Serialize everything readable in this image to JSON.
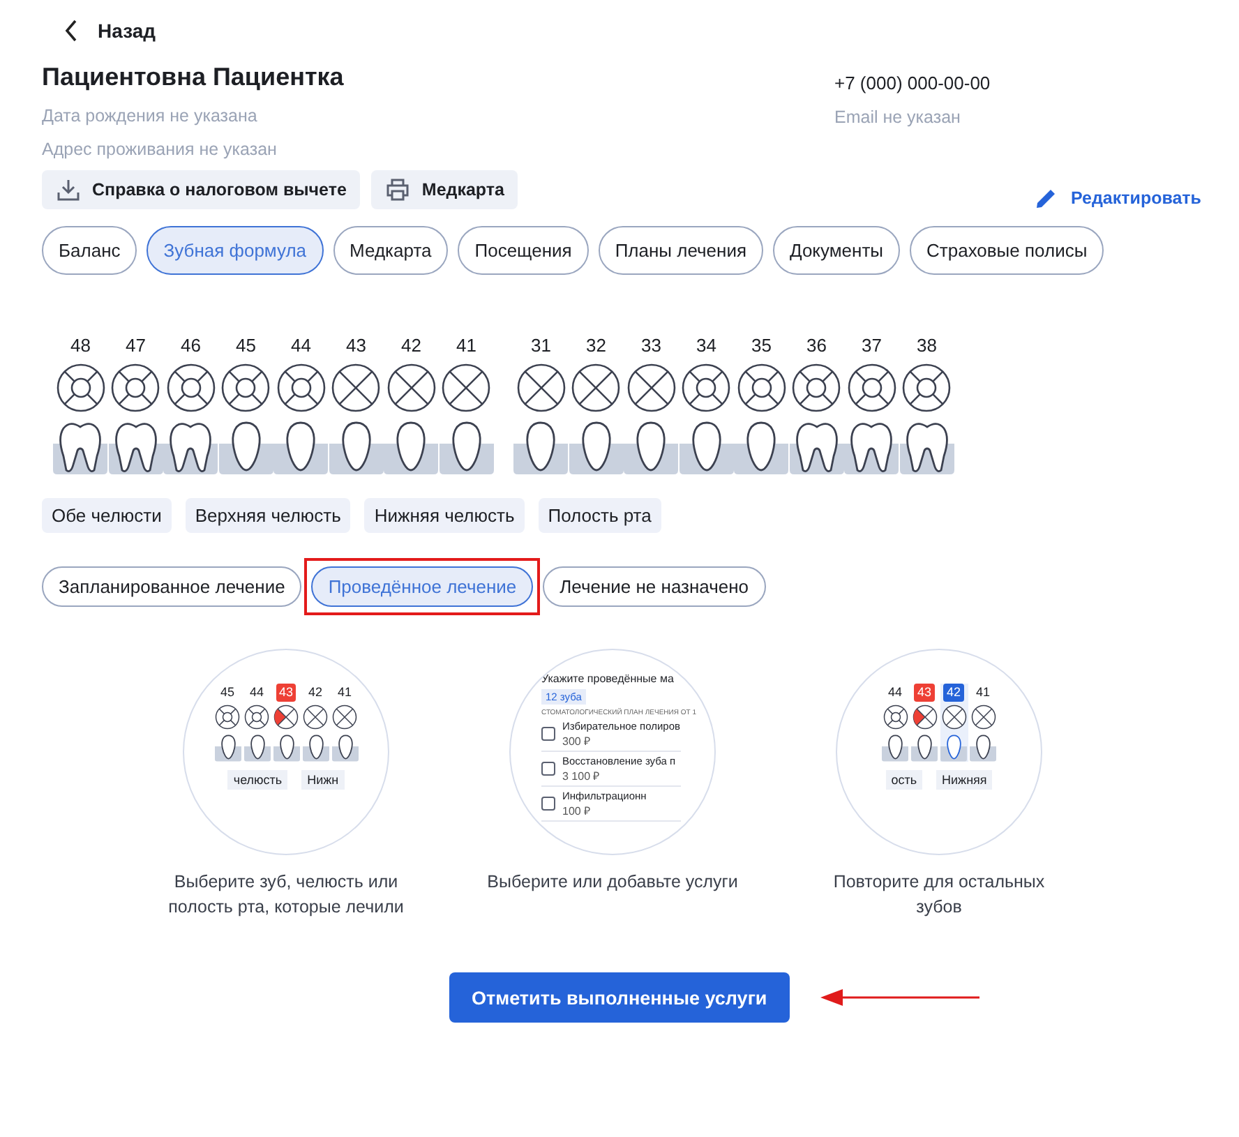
{
  "back": {
    "label": "Назад"
  },
  "patient": {
    "name": "Пациентовна Пациентка",
    "birth": "Дата рождения не указана",
    "address": "Адрес проживания не указан",
    "phone": "+7 (000) 000-00-00",
    "email": "Email не указан"
  },
  "actions": [
    {
      "kind": "download",
      "label": "Справка о налоговом вычете"
    },
    {
      "kind": "print",
      "label": "Медкарта"
    }
  ],
  "edit": {
    "label": "Редактировать"
  },
  "tabs": [
    {
      "label": "Баланс",
      "selected": false
    },
    {
      "label": "Зубная формула",
      "selected": true
    },
    {
      "label": "Медкарта",
      "selected": false
    },
    {
      "label": "Посещения",
      "selected": false
    },
    {
      "label": "Планы лечения",
      "selected": false
    },
    {
      "label": "Документы",
      "selected": false
    },
    {
      "label": "Страховые полисы",
      "selected": false
    }
  ],
  "teeth_groups": [
    [
      {
        "number": "48",
        "kind": "molar",
        "missing": false
      },
      {
        "number": "47",
        "kind": "molar",
        "missing": false
      },
      {
        "number": "46",
        "kind": "molar",
        "missing": false
      },
      {
        "number": "45",
        "kind": "incisor",
        "missing": false
      },
      {
        "number": "44",
        "kind": "incisor",
        "missing": false
      },
      {
        "number": "43",
        "kind": "incisor",
        "missing": true
      },
      {
        "number": "42",
        "kind": "incisor",
        "missing": true
      },
      {
        "number": "41",
        "kind": "incisor",
        "missing": true
      }
    ],
    [
      {
        "number": "31",
        "kind": "incisor",
        "missing": true
      },
      {
        "number": "32",
        "kind": "incisor",
        "missing": true
      },
      {
        "number": "33",
        "kind": "incisor",
        "missing": true
      },
      {
        "number": "34",
        "kind": "incisor",
        "missing": false
      },
      {
        "number": "35",
        "kind": "incisor",
        "missing": false
      },
      {
        "number": "36",
        "kind": "molar",
        "missing": false
      },
      {
        "number": "37",
        "kind": "molar",
        "missing": false
      },
      {
        "number": "38",
        "kind": "molar",
        "missing": false
      }
    ]
  ],
  "jaw_buttons": [
    "Обе челюсти",
    "Верхняя челюсть",
    "Нижняя челюсть",
    "Полость рта"
  ],
  "treatment_filters": [
    {
      "label": "Запланированное лечение",
      "selected": false,
      "annotated": false
    },
    {
      "label": "Проведённое лечение",
      "selected": true,
      "annotated": true
    },
    {
      "label": "Лечение не назначено",
      "selected": false,
      "annotated": false
    }
  ],
  "steps": [
    {
      "kind": "teeth",
      "teeth": [
        {
          "number": "45",
          "missing": false,
          "treated": false,
          "selected": false
        },
        {
          "number": "44",
          "missing": false,
          "treated": false,
          "selected": false
        },
        {
          "number": "43",
          "missing": true,
          "treated": true,
          "selected": false
        },
        {
          "number": "42",
          "missing": true,
          "treated": false,
          "selected": false
        },
        {
          "number": "41",
          "missing": true,
          "treated": false,
          "selected": false
        }
      ],
      "chips": [
        "челюсть",
        "Нижн"
      ],
      "caption": "Выберите зуб, челюсть или полость рта, которые лечили"
    },
    {
      "kind": "services",
      "title": "Укажите проведённые ма",
      "badge": "12 зуба",
      "subtitle": "СТОМАТОЛОГИЧЕСКИЙ ПЛАН ЛЕЧЕНИЯ ОТ 1",
      "services": [
        {
          "name": "Избирательное полиров",
          "price": "300 ₽",
          "checked": false
        },
        {
          "name": "Восстановление зуба п",
          "price": "3 100 ₽",
          "checked": false
        },
        {
          "name": "Инфильтрационн",
          "price": "100 ₽",
          "checked": false
        }
      ],
      "caption": "Выберите или добавьте услуги"
    },
    {
      "kind": "teeth",
      "teeth": [
        {
          "number": "44",
          "missing": false,
          "treated": false,
          "selected": false
        },
        {
          "number": "43",
          "missing": true,
          "treated": true,
          "selected": false
        },
        {
          "number": "42",
          "missing": true,
          "treated": false,
          "selected": true
        },
        {
          "number": "41",
          "missing": true,
          "treated": false,
          "selected": false
        }
      ],
      "chips": [
        "ость",
        "Нижняя"
      ],
      "caption": "Повторите для остальных зубов"
    }
  ],
  "cta": {
    "label": "Отметить выполненные услуги",
    "arrow": true
  }
}
